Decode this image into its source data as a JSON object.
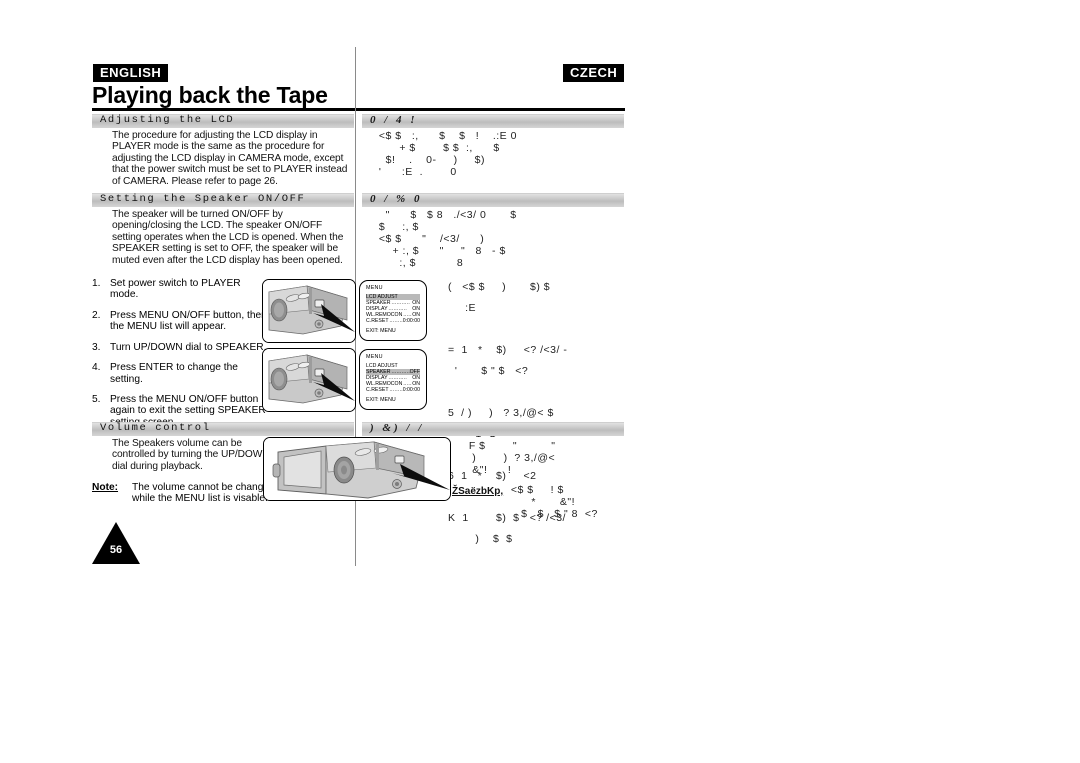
{
  "document": {
    "page_number": "56",
    "title": "Playing back the Tape",
    "language_left": "ENGLISH",
    "language_right": "CZECH"
  },
  "left_column": {
    "sections": [
      {
        "heading": "Adjusting the LCD",
        "body": "The procedure for adjusting the LCD display in PLAYER mode is the same as the procedure for adjusting the LCD display in CAMERA mode, except that the power switch must be set to PLAYER instead of CAMERA. Please refer to page 26."
      },
      {
        "heading": "Setting the Speaker ON/OFF",
        "body": "The speaker will be turned ON/OFF by opening/closing the LCD. The speaker ON/OFF setting operates when the LCD is opened. When the SPEAKER setting is set to OFF, the speaker will be muted even after the LCD display has been opened."
      },
      {
        "heading": "Volume control",
        "body": "The Speakers volume can be controlled by turning the UP/DOWN dial during playback."
      }
    ],
    "steps": [
      {
        "num": "1.",
        "text": "Set power switch to PLAYER mode."
      },
      {
        "num": "2.",
        "text": "Press MENU ON/OFF button, then the MENU list will appear."
      },
      {
        "num": "3.",
        "text": "Turn UP/DOWN dial to SPEAKER."
      },
      {
        "num": "4.",
        "text": "Press ENTER to change the setting."
      },
      {
        "num": "5.",
        "text": "Press the MENU ON/OFF button again to exit the setting SPEAKER setting screen."
      }
    ],
    "note": {
      "label": "Note:",
      "text": "The volume cannot be changed while the MENU list is visable."
    }
  },
  "right_column": {
    "sections": [
      {
        "heading": "0 /      4 !",
        "body": "  <$ $   :,      $    $   !    .:E 0\n        + $        $ $  :,      $\n    $!    .    0-     )     $)\n  '      :E  .        0"
      },
      {
        "heading": "0 /     %        0",
        "body": "    \"      $   $ 8   ./<3/ 0       $\n  $     :, $\n  <$ $      \"    /<3/      )\n      + :, $      \"     \"   8   - $\n        :, $            8"
      },
      {
        "heading": ")    &) /  /",
        "body": "  F $        \"          \"\n   )        )  ? 3,/@<\n   &\"!      !"
      }
    ],
    "steps_garbled": "(   <$ $     )       $) $\n     :E\n\n=  1   *    $)     <? /<3/ -\n  '       $ \" $   <?\n\n5  / )     )   ? 3,/@< $\n        1  O\n\n6  1   *    $)     <2\n\nK  1        $)  $   <? /<3/\n        )    $  $",
    "note": {
      "label": "ŽSaëzbKp,",
      "text": "  <$ $     ! $\n        *       &\"!\n     $   $   $ \" 8  <?"
    }
  },
  "osd_menus": [
    {
      "title": "MENU",
      "rows": [
        {
          "name": "LCD ADJUST",
          "value": "",
          "highlight": true
        },
        {
          "name": "SPEAKER",
          "value": "ON",
          "highlight": false
        },
        {
          "name": "DISPLAY",
          "value": "ON",
          "highlight": false
        },
        {
          "name": "WL.REMOCON",
          "value": "ON",
          "highlight": false
        },
        {
          "name": "C.RESET",
          "value": "0:00:00",
          "highlight": false
        }
      ],
      "exit": "EXIT: MENU"
    },
    {
      "title": "MENU",
      "rows": [
        {
          "name": "LCD ADJUST",
          "value": "",
          "highlight": false
        },
        {
          "name": "SPEAKER",
          "value": "OFF",
          "highlight": true
        },
        {
          "name": "DISPLAY",
          "value": "ON",
          "highlight": false
        },
        {
          "name": "WL.REMOCON",
          "value": "ON",
          "highlight": false
        },
        {
          "name": "C.RESET",
          "value": "0:00:00",
          "highlight": false
        }
      ],
      "exit": "EXIT: MENU"
    }
  ],
  "illustrations": [
    {
      "name": "camcorder-side-menu-button-1"
    },
    {
      "name": "camcorder-side-menu-button-2"
    },
    {
      "name": "camcorder-lcd-open-speaker"
    }
  ]
}
